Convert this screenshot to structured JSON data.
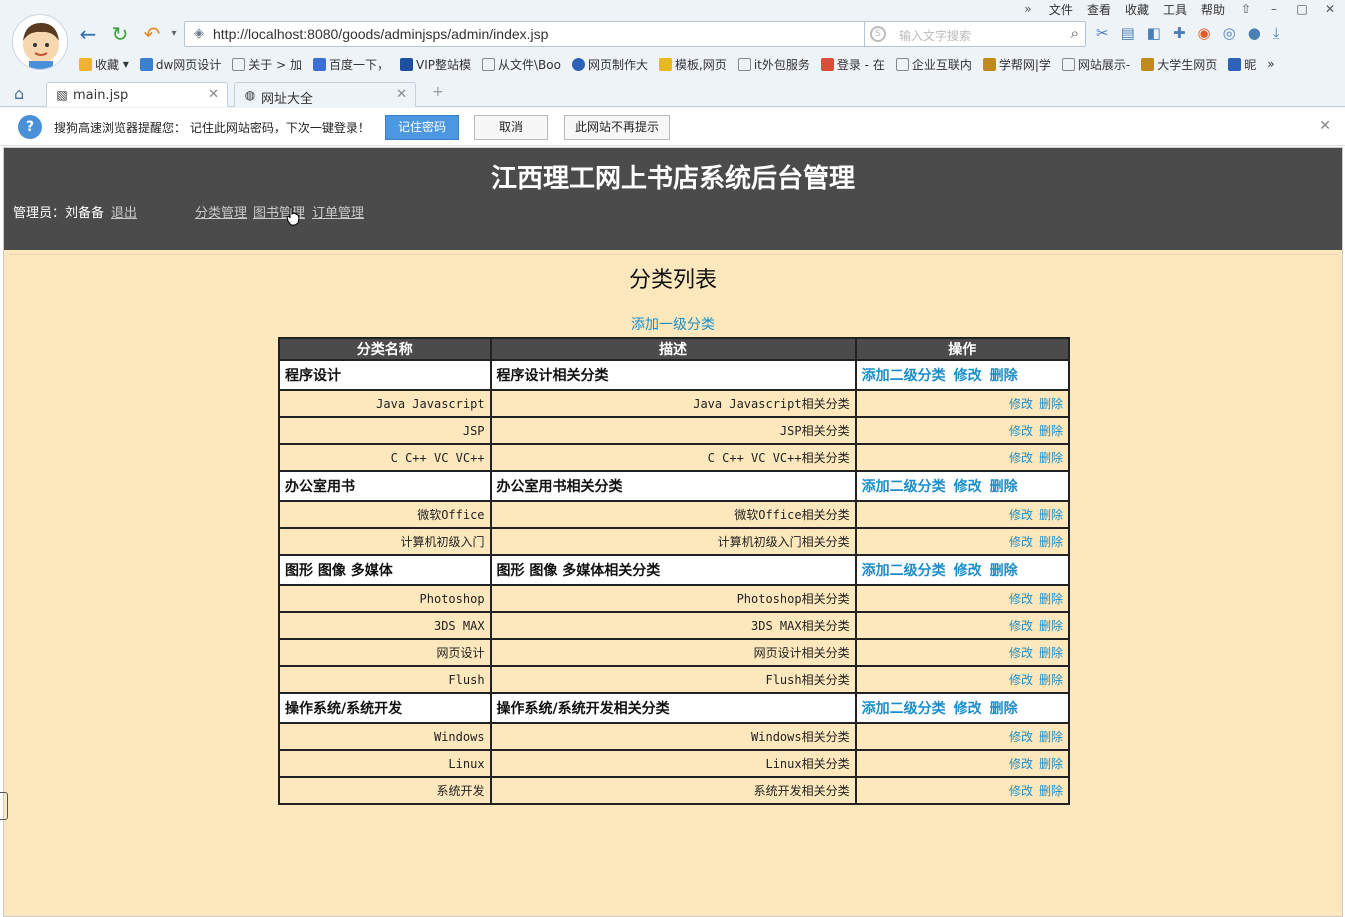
{
  "browser": {
    "menu": [
      "文件",
      "查看",
      "收藏",
      "工具",
      "帮助"
    ],
    "url": "http://localhost:8080/goods/adminjsps/admin/index.jsp",
    "search_placeholder": "输入文字搜索",
    "bookmarks": [
      "收藏",
      "dw网页设计",
      "关于 > 加",
      "百度一下，",
      "VIP整站模",
      "从文件\\Boo",
      "网页制作大",
      "模板,网页",
      "it外包服务",
      "登录 - 在",
      "企业互联内",
      "学帮网|学",
      "网站展示-",
      "大学生网页",
      "昵"
    ],
    "tabs": [
      {
        "label": "main.jsp"
      },
      {
        "label": "网址大全"
      }
    ],
    "notice": {
      "message": "搜狗高速浏览器提醒您： 记住此网站密码，下次一键登录！",
      "btn_remember": "记住密码",
      "btn_cancel": "取消",
      "btn_never": "此网站不再提示"
    }
  },
  "header": {
    "title": "江西理工网上书店系统后台管理",
    "admin_label": "管理员：刘备备",
    "logout": "退出",
    "nav": [
      "分类管理",
      "图书管理",
      "订单管理"
    ]
  },
  "main": {
    "title": "分类列表",
    "add_top": "添加一级分类",
    "columns": [
      "分类名称",
      "描述",
      "操作"
    ],
    "ops_level1": [
      "添加二级分类",
      "修改",
      "删除"
    ],
    "ops_level2": [
      "修改",
      "删除"
    ],
    "categories": [
      {
        "name": "程序设计",
        "desc": "程序设计相关分类",
        "children": [
          {
            "name": "Java Javascript",
            "desc": "Java Javascript相关分类"
          },
          {
            "name": "JSP",
            "desc": "JSP相关分类"
          },
          {
            "name": "C C++ VC VC++",
            "desc": "C C++ VC VC++相关分类"
          }
        ]
      },
      {
        "name": "办公室用书",
        "desc": "办公室用书相关分类",
        "children": [
          {
            "name": "微软Office",
            "desc": "微软Office相关分类"
          },
          {
            "name": "计算机初级入门",
            "desc": "计算机初级入门相关分类"
          }
        ]
      },
      {
        "name": "图形 图像 多媒体",
        "desc": "图形 图像 多媒体相关分类",
        "children": [
          {
            "name": "Photoshop",
            "desc": "Photoshop相关分类"
          },
          {
            "name": "3DS MAX",
            "desc": "3DS MAX相关分类"
          },
          {
            "name": "网页设计",
            "desc": "网页设计相关分类"
          },
          {
            "name": "Flush",
            "desc": "Flush相关分类"
          }
        ]
      },
      {
        "name": "操作系统/系统开发",
        "desc": "操作系统/系统开发相关分类",
        "children": [
          {
            "name": "Windows",
            "desc": "Windows相关分类"
          },
          {
            "name": "Linux",
            "desc": "Linux相关分类"
          },
          {
            "name": "系统开发",
            "desc": "系统开发相关分类"
          }
        ]
      }
    ]
  },
  "colors": {
    "header_bg": "#4b4b4b",
    "body_bg": "#fde8bd",
    "link": "#1a8ecb"
  }
}
